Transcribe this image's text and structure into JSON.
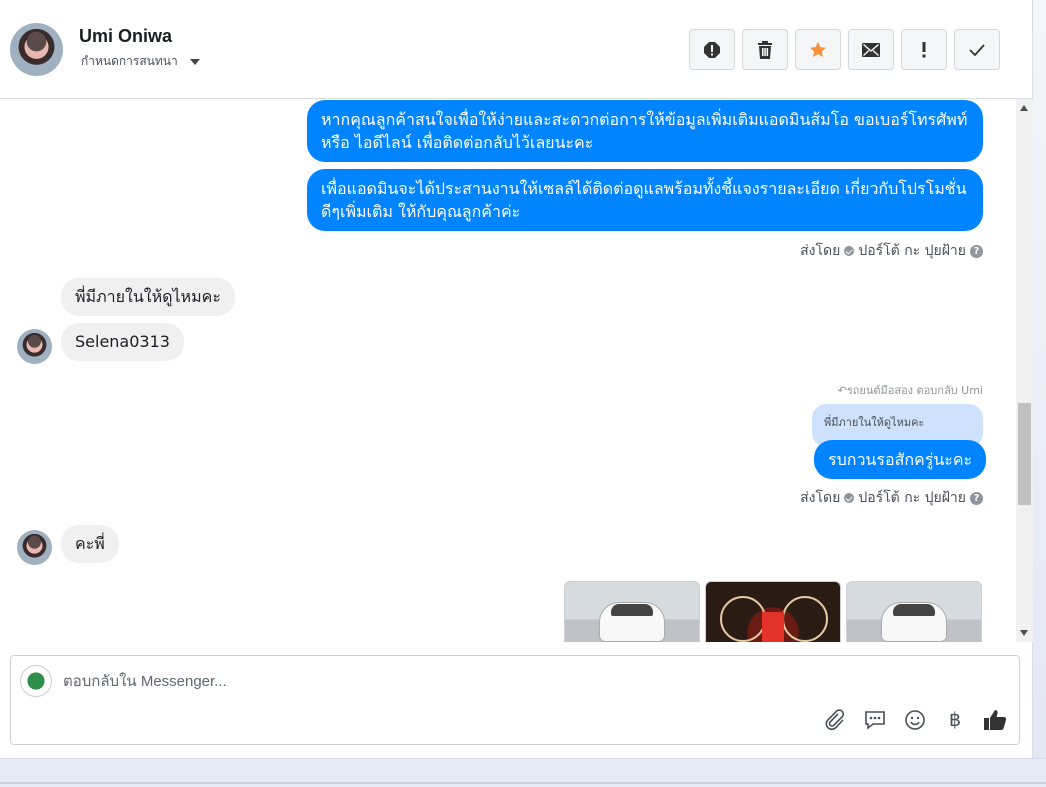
{
  "header": {
    "contact_name": "Umi Oniwa",
    "conversation_settings": "กำหนดการสนทนา"
  },
  "toolbar": {
    "buttons": [
      "alert-circle-icon",
      "trash-icon",
      "star-icon",
      "envelope-icon",
      "exclamation-icon",
      "checkmark-icon"
    ],
    "star_color": "#f7923b"
  },
  "messages": {
    "out_1": "หากคุณลูกค้าสนใจเพื่อให้ง่ายและสะดวกต่อการให้ข้อมูลเพิ่มเติมแอดมินส้มโอ ขอเบอร์โทรศัพท์ หรือ ไอดีไลน์ เพื่อติดต่อกลับไว้เลยนะคะ",
    "out_2": "เพื่อแอดมินจะได้ประสานงานให้เซลล์ได้ติดต่อดูแลพร้อมทั้งชี้แจงรายละเอียด เกี่ยวกับโปรโมชั่นดีๆเพิ่มเติม ให้กับคุณลูกค้าค่ะ",
    "sent_by_prefix": "ส่งโดย",
    "sent_by_name": "ปอร์โต้ กะ ปุยฝ้าย",
    "in_1": "พี่มีภายในให้ดูไหมคะ",
    "in_2": "Selena0313",
    "reply_label": "รถยนต์มือสอง ตอบกลับ Umi",
    "quoted_text": "พี่มีภายในให้ดูไหมคะ",
    "out_3": "รบกวนรอสักครู่นะคะ",
    "in_3": "คะพี่"
  },
  "composer": {
    "placeholder": "ตอบกลับใน Messenger...",
    "tools": [
      "attachment-icon",
      "saved-reply-icon",
      "emoji-icon",
      "currency-icon",
      "thumbs-up-icon"
    ],
    "currency_symbol": "฿"
  },
  "colors": {
    "outgoing_bubble": "#0084ff",
    "incoming_bubble": "#f1f0f0",
    "quoted_bubble": "#cfe2fd"
  }
}
